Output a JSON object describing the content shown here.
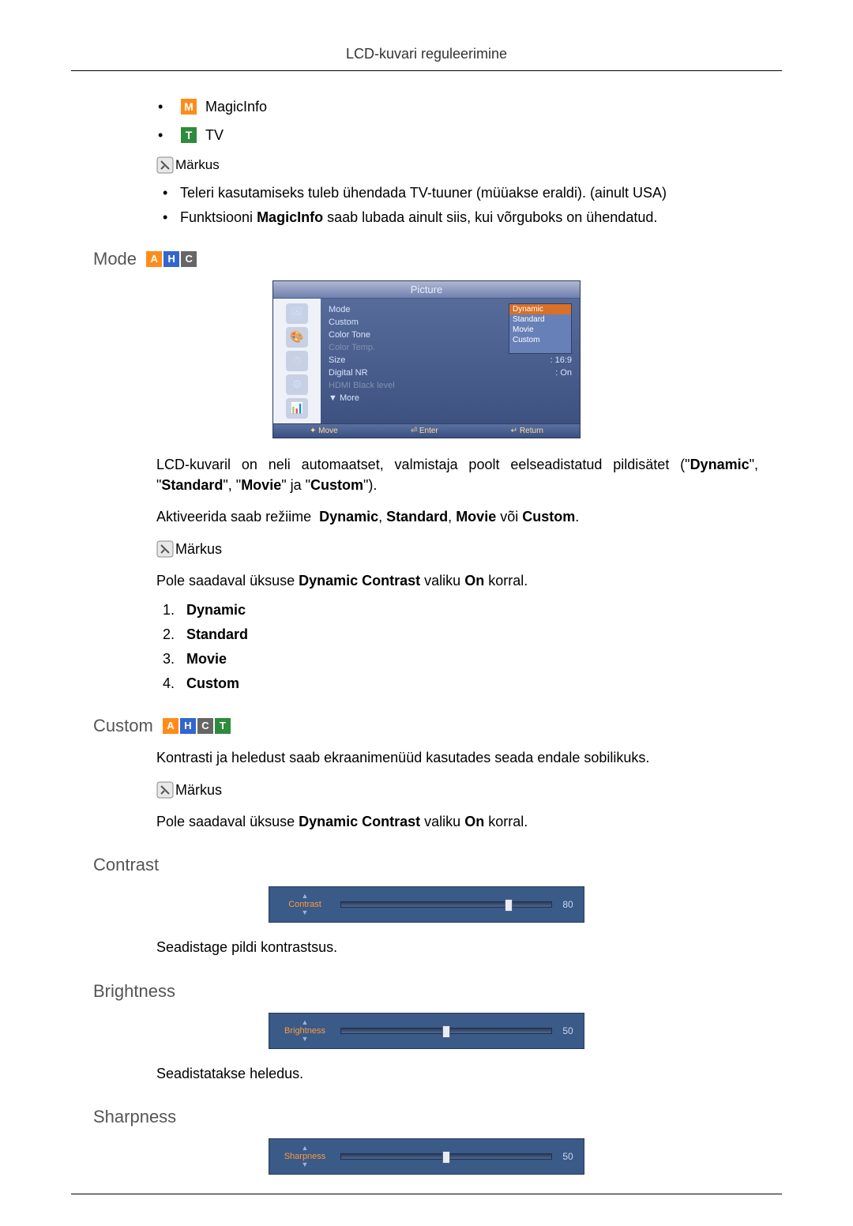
{
  "header": {
    "title": "LCD-kuvari reguleerimine"
  },
  "topItems": [
    {
      "icon": "M",
      "iconColor": "#ff8c1a",
      "label": "MagicInfo"
    },
    {
      "icon": "T",
      "iconColor": "#2e8b3d",
      "label": "TV"
    }
  ],
  "noteLabel": "Märkus",
  "notes1": [
    "Teleri kasutamiseks tuleb ühendada TV-tuuner (müüakse eraldi). (ainult USA)",
    "Funktsiooni MagicInfo saab lubada ainult siis, kui võrguboks on ühendatud."
  ],
  "notes1Bold": {
    "1": "MagicInfo"
  },
  "sections": {
    "mode": {
      "title": "Mode",
      "badges": [
        "A",
        "H",
        "C"
      ],
      "para1": "LCD-kuvaril on neli automaatset, valmistaja poolt eelseadistatud pildisätet (\"Dynamic\", \"Standard\", \"Movie\" ja \"Custom\").",
      "para2": "Aktiveerida saab režiime  Dynamic, Standard, Movie või Custom.",
      "note": "Pole saadaval üksuse Dynamic Contrast valiku On korral.",
      "list": [
        "Dynamic",
        "Standard",
        "Movie",
        "Custom"
      ]
    },
    "custom": {
      "title": "Custom",
      "badges": [
        "A",
        "H",
        "C",
        "T"
      ],
      "para1": "Kontrasti ja heledust saab ekraanimenüüd kasutades seada endale sobilikuks.",
      "note": "Pole saadaval üksuse Dynamic Contrast valiku On korral."
    },
    "contrast": {
      "title": "Contrast",
      "sliderLabel": "Contrast",
      "value": 80,
      "desc": "Seadistage pildi kontrastsus."
    },
    "brightness": {
      "title": "Brightness",
      "sliderLabel": "Brightness",
      "value": 50,
      "desc": "Seadistatakse heledus."
    },
    "sharpness": {
      "title": "Sharpness",
      "sliderLabel": "Sharpness",
      "value": 50
    }
  },
  "menu": {
    "header": "Picture",
    "items": [
      {
        "k": "Mode",
        "dropdown": [
          "Dynamic",
          "Standard",
          "Movie",
          "Custom"
        ],
        "sel": 0
      },
      {
        "k": "Custom"
      },
      {
        "k": "Color Tone"
      },
      {
        "k": "Color Temp.",
        "dim": true
      },
      {
        "k": "Size",
        "v": ": 16:9"
      },
      {
        "k": "Digital NR",
        "v": ": On"
      },
      {
        "k": "HDMI Black level",
        "dim": true
      },
      {
        "k": "▼   More"
      }
    ],
    "footer": [
      "✦ Move",
      "⏎ Enter",
      "↵ Return"
    ]
  }
}
